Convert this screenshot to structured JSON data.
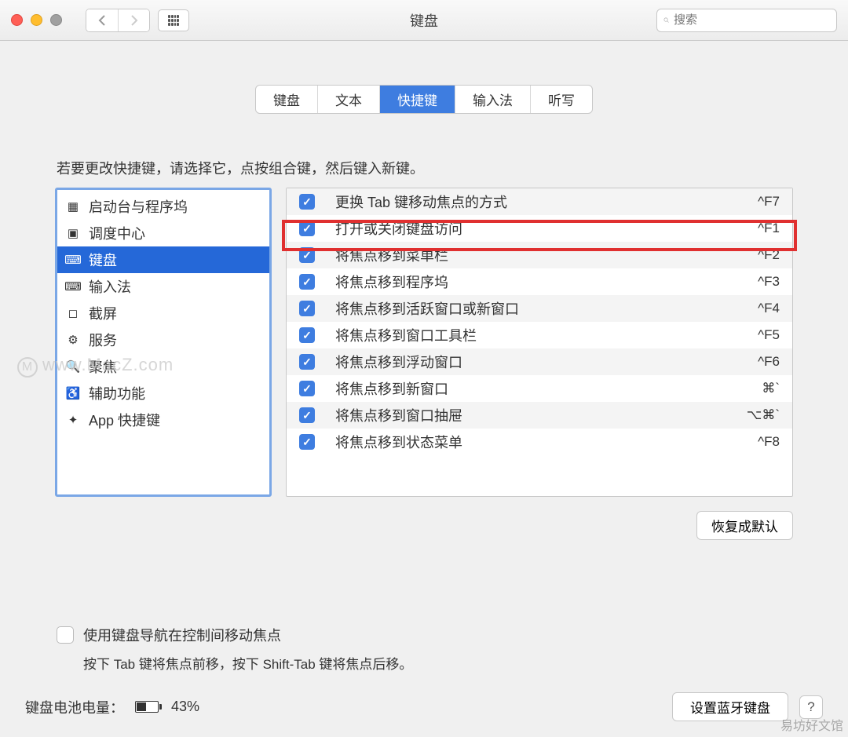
{
  "window": {
    "title": "键盘"
  },
  "search": {
    "placeholder": "搜索"
  },
  "tabs": [
    "键盘",
    "文本",
    "快捷键",
    "输入法",
    "听写"
  ],
  "active_tab_index": 2,
  "instruction": "若要更改快捷键，请选择它，点按组合键，然后键入新键。",
  "sidebar": {
    "items": [
      {
        "label": "启动台与程序坞",
        "icon": "dashboard-icon"
      },
      {
        "label": "调度中心",
        "icon": "mission-control-icon"
      },
      {
        "label": "键盘",
        "icon": "keyboard-icon"
      },
      {
        "label": "输入法",
        "icon": "input-source-icon"
      },
      {
        "label": "截屏",
        "icon": "screenshot-icon"
      },
      {
        "label": "服务",
        "icon": "services-icon"
      },
      {
        "label": "聚焦",
        "icon": "spotlight-icon"
      },
      {
        "label": "辅助功能",
        "icon": "accessibility-icon"
      },
      {
        "label": "App 快捷键",
        "icon": "app-shortcuts-icon"
      }
    ],
    "selected_index": 2
  },
  "shortcuts": [
    {
      "checked": true,
      "label": "更换 Tab 键移动焦点的方式",
      "key": "^F7"
    },
    {
      "checked": true,
      "label": "打开或关闭键盘访问",
      "key": "^F1"
    },
    {
      "checked": true,
      "label": "将焦点移到菜单栏",
      "key": "^F2"
    },
    {
      "checked": true,
      "label": "将焦点移到程序坞",
      "key": "^F3"
    },
    {
      "checked": true,
      "label": "将焦点移到活跃窗口或新窗口",
      "key": "^F4"
    },
    {
      "checked": true,
      "label": "将焦点移到窗口工具栏",
      "key": "^F5"
    },
    {
      "checked": true,
      "label": "将焦点移到浮动窗口",
      "key": "^F6"
    },
    {
      "checked": true,
      "label": "将焦点移到新窗口",
      "key": "⌘`"
    },
    {
      "checked": true,
      "label": "将焦点移到窗口抽屉",
      "key": "⌥⌘`"
    },
    {
      "checked": true,
      "label": "将焦点移到状态菜单",
      "key": "^F8"
    }
  ],
  "highlighted_shortcut_index": 1,
  "restore_button": "恢复成默认",
  "keyboard_nav": {
    "checkbox_label": "使用键盘导航在控制间移动焦点",
    "hint": "按下 Tab 键将焦点前移，按下 Shift-Tab 键将焦点后移。"
  },
  "footer": {
    "battery_label": "键盘电池电量：",
    "battery_percent": "43%",
    "bluetooth_button": "设置蓝牙键盘",
    "help": "?"
  },
  "watermark": "www.MacZ.com",
  "watermark2": "易坊好文馆"
}
